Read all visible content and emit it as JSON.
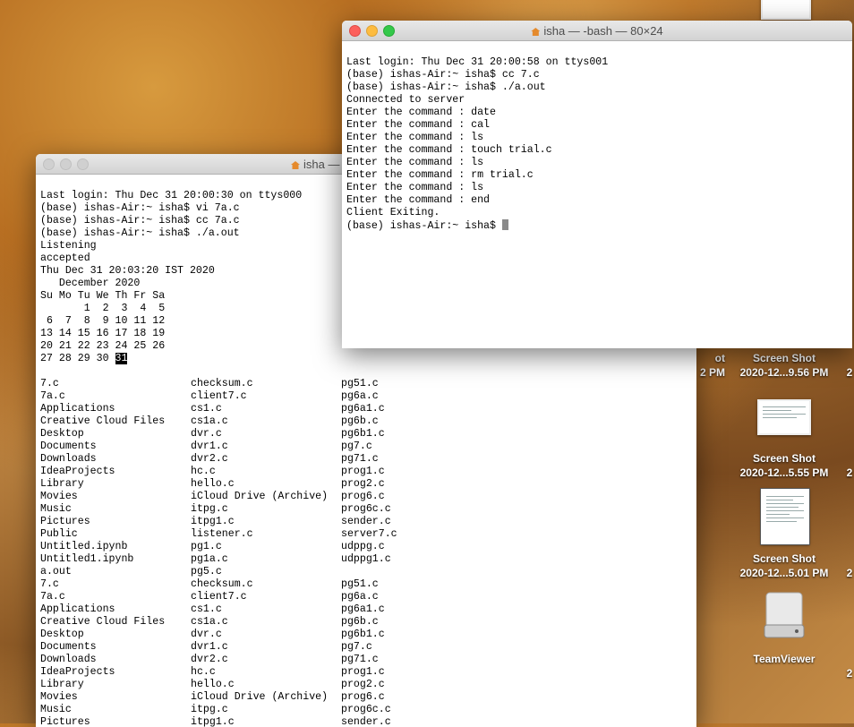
{
  "desktop": {
    "partial_left_label_top": "ot",
    "partial_left_label_bottom": "2 PM",
    "screenshots": [
      {
        "line1": "Screen Shot",
        "line2": "2020-12...9.56 PM"
      },
      {
        "line1": "Screen Shot",
        "line2": "2020-12...5.55 PM"
      },
      {
        "line1": "Screen Shot",
        "line2": "2020-12...5.01 PM"
      }
    ],
    "drive": {
      "label": "TeamViewer",
      "icon": "external-drive-icon"
    },
    "right_edge_partial": "2"
  },
  "window_back": {
    "title": "isha —",
    "lines": [
      "Last login: Thu Dec 31 20:00:30 on ttys000",
      "(base) ishas-Air:~ isha$ vi 7a.c",
      "(base) ishas-Air:~ isha$ cc 7a.c",
      "(base) ishas-Air:~ isha$ ./a.out",
      "Listening",
      "accepted",
      "Thu Dec 31 20:03:20 IST 2020",
      "   December 2020",
      "Su Mo Tu We Th Fr Sa",
      "       1  2  3  4  5",
      " 6  7  8  9 10 11 12",
      "13 14 15 16 17 18 19",
      "20 21 22 23 24 25 26"
    ],
    "cal_last_prefix": "27 28 29 30 ",
    "cal_today": "31",
    "listing1": [
      [
        "7.c",
        "checksum.c",
        "pg51.c"
      ],
      [
        "7a.c",
        "client7.c",
        "pg6a.c"
      ],
      [
        "Applications",
        "cs1.c",
        "pg6a1.c"
      ],
      [
        "Creative Cloud Files",
        "cs1a.c",
        "pg6b.c"
      ],
      [
        "Desktop",
        "dvr.c",
        "pg6b1.c"
      ],
      [
        "Documents",
        "dvr1.c",
        "pg7.c"
      ],
      [
        "Downloads",
        "dvr2.c",
        "pg71.c"
      ],
      [
        "IdeaProjects",
        "hc.c",
        "prog1.c"
      ],
      [
        "Library",
        "hello.c",
        "prog2.c"
      ],
      [
        "Movies",
        "iCloud Drive (Archive)",
        "prog6.c"
      ],
      [
        "Music",
        "itpg.c",
        "prog6c.c"
      ],
      [
        "Pictures",
        "itpg1.c",
        "sender.c"
      ],
      [
        "Public",
        "listener.c",
        "server7.c"
      ],
      [
        "Untitled.ipynb",
        "pg1.c",
        "udppg.c"
      ],
      [
        "Untitled1.ipynb",
        "pg1a.c",
        "udppg1.c"
      ],
      [
        "a.out",
        "pg5.c",
        ""
      ]
    ],
    "listing2": [
      [
        "7.c",
        "checksum.c",
        "pg51.c"
      ],
      [
        "7a.c",
        "client7.c",
        "pg6a.c"
      ],
      [
        "Applications",
        "cs1.c",
        "pg6a1.c"
      ],
      [
        "Creative Cloud Files",
        "cs1a.c",
        "pg6b.c"
      ],
      [
        "Desktop",
        "dvr.c",
        "pg6b1.c"
      ],
      [
        "Documents",
        "dvr1.c",
        "pg7.c"
      ],
      [
        "Downloads",
        "dvr2.c",
        "pg71.c"
      ],
      [
        "IdeaProjects",
        "hc.c",
        "prog1.c"
      ],
      [
        "Library",
        "hello.c",
        "prog2.c"
      ],
      [
        "Movies",
        "iCloud Drive (Archive)",
        "prog6.c"
      ],
      [
        "Music",
        "itpg.c",
        "prog6c.c"
      ],
      [
        "Pictures",
        "itpg1.c",
        "sender.c"
      ]
    ]
  },
  "window_front": {
    "title": "isha — -bash — 80×24",
    "lines": [
      "Last login: Thu Dec 31 20:00:58 on ttys001",
      "(base) ishas-Air:~ isha$ cc 7.c",
      "(base) ishas-Air:~ isha$ ./a.out",
      "Connected to server",
      "Enter the command : date",
      "Enter the command : cal",
      "Enter the command : ls",
      "Enter the command : touch trial.c",
      "Enter the command : ls",
      "Enter the command : rm trial.c",
      "Enter the command : ls",
      "Enter the command : end",
      "Client Exiting."
    ],
    "prompt": "(base) ishas-Air:~ isha$ "
  },
  "colors": {
    "close": "#fc605c",
    "minimize": "#fdbc40",
    "zoom": "#34c84a"
  }
}
